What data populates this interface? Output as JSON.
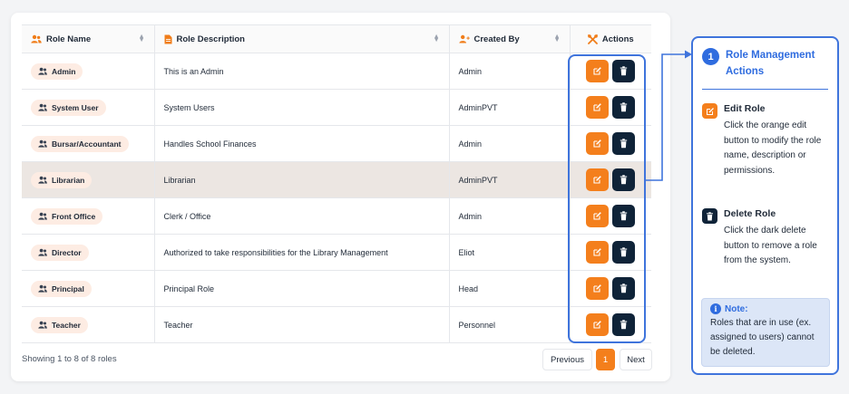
{
  "table": {
    "headers": {
      "role_name": "Role Name",
      "role_description": "Role Description",
      "created_by": "Created By",
      "actions": "Actions"
    },
    "rows": [
      {
        "role": "Admin",
        "description": "This is an Admin",
        "created_by": "Admin",
        "highlighted": false
      },
      {
        "role": "System User",
        "description": "System Users",
        "created_by": "AdminPVT",
        "highlighted": false
      },
      {
        "role": "Bursar/Accountant",
        "description": "Handles School Finances",
        "created_by": "Admin",
        "highlighted": false
      },
      {
        "role": "Librarian",
        "description": "Librarian",
        "created_by": "AdminPVT",
        "highlighted": true
      },
      {
        "role": "Front Office",
        "description": "Clerk / Office",
        "created_by": "Admin",
        "highlighted": false
      },
      {
        "role": "Director",
        "description": "Authorized to take responsibilities for the Library Management",
        "created_by": "Eliot",
        "highlighted": false
      },
      {
        "role": "Principal",
        "description": "Principal Role",
        "created_by": "Head",
        "highlighted": false
      },
      {
        "role": "Teacher",
        "description": "Teacher",
        "created_by": "Personnel",
        "highlighted": false
      }
    ]
  },
  "footer": {
    "showing": "Showing 1 to 8 of 8 roles",
    "previous": "Previous",
    "current_page": "1",
    "next": "Next"
  },
  "side_panel": {
    "step_number": "1",
    "title": "Role Management Actions",
    "edit_title": "Edit Role",
    "edit_text": "Click the orange edit button to modify the role name, description or permissions.",
    "delete_title": "Delete Role",
    "delete_text": "Click the dark delete button to remove a role from the system.",
    "note_title": "Note:",
    "note_text": "Roles that are in use (ex. assigned to users) cannot be deleted."
  },
  "colors": {
    "accent_orange": "#f47f1c",
    "dark_navy": "#0f2338",
    "callout_blue": "#3f74dc",
    "badge_bg": "#fdece3",
    "highlight_row": "#ece6e2",
    "note_bg": "#dce6f7"
  },
  "icons": {
    "header_role_name": "users-icon",
    "header_description": "file-icon",
    "header_created_by": "user-plus-icon",
    "header_actions": "tools-icon",
    "edit": "edit-icon",
    "delete": "trash-icon"
  }
}
